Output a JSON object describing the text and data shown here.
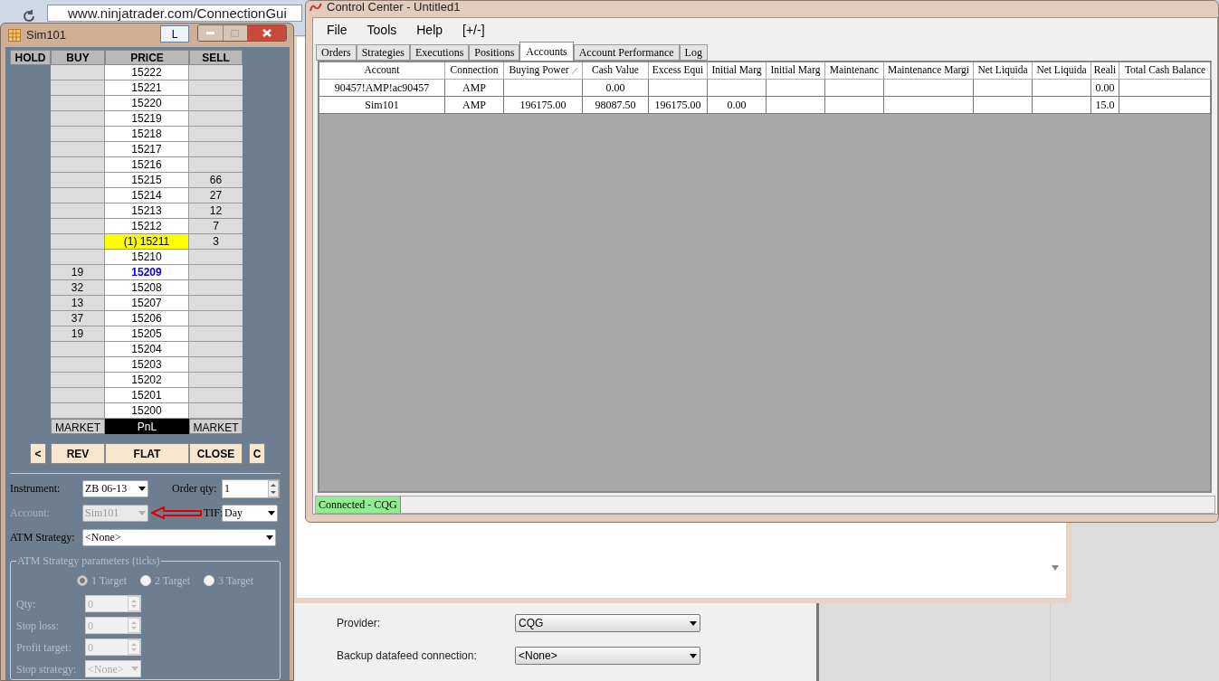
{
  "browser": {
    "url": "www.ninjatrader.com/ConnectionGui"
  },
  "dom_window": {
    "title": "Sim101",
    "link_button": "L",
    "columns": [
      "HOLD",
      "BUY",
      "PRICE",
      "SELL"
    ],
    "rows": [
      {
        "buy": "",
        "price": "15222",
        "sell": "",
        "kind": "normal"
      },
      {
        "buy": "",
        "price": "15221",
        "sell": "",
        "kind": "normal"
      },
      {
        "buy": "",
        "price": "15220",
        "sell": "",
        "kind": "normal"
      },
      {
        "buy": "",
        "price": "15219",
        "sell": "",
        "kind": "normal"
      },
      {
        "buy": "",
        "price": "15218",
        "sell": "",
        "kind": "normal"
      },
      {
        "buy": "",
        "price": "15217",
        "sell": "",
        "kind": "normal"
      },
      {
        "buy": "",
        "price": "15216",
        "sell": "",
        "kind": "normal"
      },
      {
        "buy": "",
        "price": "15215",
        "sell": "66",
        "kind": "normal"
      },
      {
        "buy": "",
        "price": "15214",
        "sell": "27",
        "kind": "normal"
      },
      {
        "buy": "",
        "price": "15213",
        "sell": "12",
        "kind": "normal"
      },
      {
        "buy": "",
        "price": "15212",
        "sell": "7",
        "kind": "normal"
      },
      {
        "buy": "",
        "price": "(1) 15211",
        "sell": "3",
        "kind": "position"
      },
      {
        "buy": "",
        "price": "15210",
        "sell": "",
        "kind": "normal"
      },
      {
        "buy": "19",
        "price": "15209",
        "sell": "",
        "kind": "last"
      },
      {
        "buy": "32",
        "price": "15208",
        "sell": "",
        "kind": "normal"
      },
      {
        "buy": "13",
        "price": "15207",
        "sell": "",
        "kind": "normal"
      },
      {
        "buy": "37",
        "price": "15206",
        "sell": "",
        "kind": "normal"
      },
      {
        "buy": "19",
        "price": "15205",
        "sell": "",
        "kind": "normal"
      },
      {
        "buy": "",
        "price": "15204",
        "sell": "",
        "kind": "normal"
      },
      {
        "buy": "",
        "price": "15203",
        "sell": "",
        "kind": "normal"
      },
      {
        "buy": "",
        "price": "15202",
        "sell": "",
        "kind": "normal"
      },
      {
        "buy": "",
        "price": "15201",
        "sell": "",
        "kind": "normal"
      },
      {
        "buy": "",
        "price": "15200",
        "sell": "",
        "kind": "normal"
      }
    ],
    "footer": [
      "MARKET",
      "PnL",
      "MARKET"
    ],
    "actions": [
      "<",
      "REV",
      "FLAT",
      "CLOSE",
      "C"
    ],
    "instrument": {
      "label": "Instrument:",
      "value": "ZB 06-13"
    },
    "order_qty": {
      "label": "Order qty:",
      "value": "1"
    },
    "account": {
      "label": "Account:",
      "value": "Sim101",
      "disabled": true
    },
    "tif": {
      "label": "TIF:",
      "value": "Day"
    },
    "atm_strategy": {
      "label": "ATM Strategy:",
      "value": "<None>"
    },
    "atm_params": {
      "title": "ATM Strategy parameters (ticks)",
      "targets": [
        {
          "label": "1 Target",
          "selected": true
        },
        {
          "label": "2 Target",
          "selected": false
        },
        {
          "label": "3 Target",
          "selected": false
        }
      ],
      "fields": [
        {
          "label": "Qty:",
          "value": "0",
          "kind": "spinner"
        },
        {
          "label": "Stop loss:",
          "value": "0",
          "kind": "spinner"
        },
        {
          "label": "Profit target:",
          "value": "0",
          "kind": "spinner"
        },
        {
          "label": "Stop strategy:",
          "value": "<None>",
          "kind": "dropdown"
        }
      ]
    }
  },
  "control_center": {
    "title": "Control Center - Untitled1",
    "menu": [
      "File",
      "Tools",
      "Help",
      "[+/-]"
    ],
    "tabs": [
      {
        "label": "Orders",
        "selected": false
      },
      {
        "label": "Strategies",
        "selected": false
      },
      {
        "label": "Executions",
        "selected": false
      },
      {
        "label": "Positions",
        "selected": false
      },
      {
        "label": "Accounts",
        "selected": true
      },
      {
        "label": "Account Performance",
        "selected": false
      },
      {
        "label": "Log",
        "selected": false
      }
    ],
    "table": {
      "columns": [
        "Account",
        "Connection",
        "Buying Power",
        "Cash Value",
        "Excess Equi",
        "Initial Marg",
        "Initial Marg",
        "Maintenanc",
        "Maintenance Margi",
        "Net Liquida",
        "Net Liquida",
        "Reali",
        "Total Cash Balance"
      ],
      "rows": [
        [
          "90457!AMP!ac90457",
          "AMP",
          "",
          "0.00",
          "",
          "",
          "",
          "",
          "",
          "",
          "",
          "0.00",
          ""
        ],
        [
          "Sim101",
          "AMP",
          "196175.00",
          "98087.50",
          "196175.00",
          "0.00",
          "",
          "",
          "",
          "",
          "",
          "15.0",
          ""
        ]
      ]
    },
    "status": "Connected - CQG"
  },
  "settings": {
    "fields": [
      {
        "label": "Provider:",
        "value": "CQG"
      },
      {
        "label": "Backup datafeed connection:",
        "value": "<None>"
      }
    ]
  }
}
